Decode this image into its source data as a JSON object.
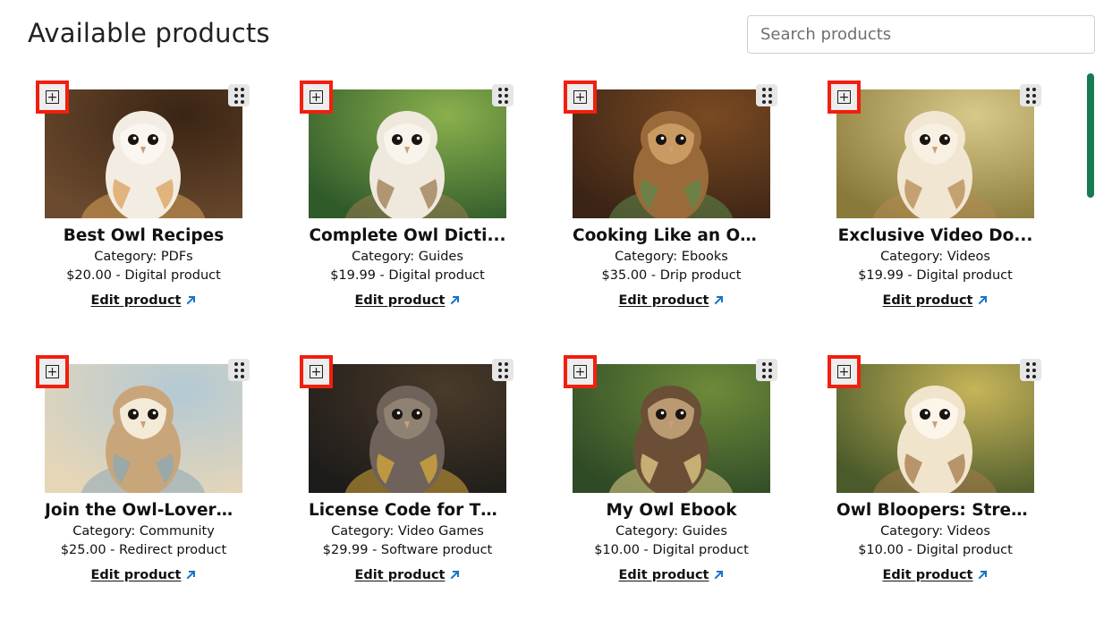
{
  "header": {
    "title": "Available products",
    "search_placeholder": "Search products"
  },
  "icons": {
    "add": "plus-square-icon",
    "drag": "drag-handle-icon",
    "external": "external-link-arrow-icon"
  },
  "colors": {
    "accent_red": "#f21f0e",
    "scrollbar": "#187a55",
    "link_arrow": "#1a73c9"
  },
  "products": [
    {
      "name": "Best Owl Recipes",
      "category": "Category: PDFs",
      "price": "$20.00 - Digital product",
      "edit_label": "Edit product",
      "image": "owl-baker"
    },
    {
      "name": "Complete Owl Dicti...",
      "category": "Category: Guides",
      "price": "$19.99 - Digital product",
      "edit_label": "Edit product",
      "image": "white-owl"
    },
    {
      "name": "Cooking Like an Ow...",
      "category": "Category: Ebooks",
      "price": "$35.00 - Drip product",
      "edit_label": "Edit product",
      "image": "owl-cook"
    },
    {
      "name": "Exclusive Video Do...",
      "category": "Category: Videos",
      "price": "$19.99 - Digital product",
      "edit_label": "Edit product",
      "image": "owl-flying"
    },
    {
      "name": "Join the Owl-Lovers ...",
      "category": "Category: Community",
      "price": "$25.00 - Redirect product",
      "edit_label": "Edit product",
      "image": "owl-family"
    },
    {
      "name": "License Code for Th...",
      "category": "Category: Video Games",
      "price": "$29.99 - Software product",
      "edit_label": "Edit product",
      "image": "owl-detective"
    },
    {
      "name": "My Owl Ebook",
      "category": "Category: Guides",
      "price": "$10.00 - Digital product",
      "edit_label": "Edit product",
      "image": "owl-ebook"
    },
    {
      "name": "Owl Bloopers: Strea...",
      "category": "Category: Videos",
      "price": "$10.00 - Digital product",
      "edit_label": "Edit product",
      "image": "owl-forest"
    }
  ]
}
